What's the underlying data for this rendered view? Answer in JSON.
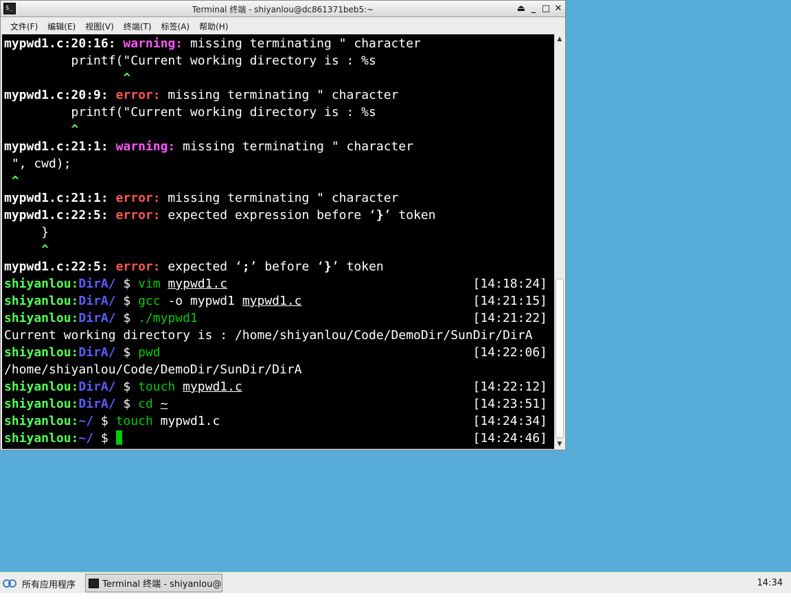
{
  "window": {
    "title": "Terminal 终端 - shiyanlou@dc861371beb5:~",
    "icon": "terminal-icon",
    "controls": [
      "shade-icon",
      "minimize-icon",
      "maximize-icon",
      "close-icon"
    ]
  },
  "menu": [
    {
      "label": "文件(F)"
    },
    {
      "label": "编辑(E)"
    },
    {
      "label": "视图(V)"
    },
    {
      "label": "终端(T)"
    },
    {
      "label": "标签(A)"
    },
    {
      "label": "帮助(H)"
    }
  ],
  "terminal": {
    "lines": [
      {
        "loc": "mypwd1.c:20:16:",
        "kind": "warning:",
        "msg": " missing terminating \" character"
      },
      {
        "text": "         printf(\"Current working directory is : %s"
      },
      {
        "caret": "                ^"
      },
      {
        "loc": "mypwd1.c:20:9:",
        "kind": "error:",
        "msg": " missing terminating \" character"
      },
      {
        "text": "         printf(\"Current working directory is : %s"
      },
      {
        "caret": "         ^"
      },
      {
        "loc": "mypwd1.c:21:1:",
        "kind": "warning:",
        "msg": " missing terminating \" character"
      },
      {
        "text": " \", cwd);"
      },
      {
        "caret": " ^"
      },
      {
        "loc": "mypwd1.c:21:1:",
        "kind": "error:",
        "msg": " missing terminating \" character"
      },
      {
        "loc": "mypwd1.c:22:5:",
        "kind": "error:",
        "msg": " expected expression before ",
        "q1": "‘",
        "bold_tok": "}",
        "q2": "’",
        "tail": " token"
      },
      {
        "text": "     }"
      },
      {
        "caret": "     ^"
      },
      {
        "loc": "mypwd1.c:22:5:",
        "kind": "error:",
        "msg": " expected ",
        "q1": "‘",
        "bold_tok": ";",
        "q2": "’",
        "mid": " before ",
        "q3": "‘",
        "bold_tok2": "}",
        "q4": "’",
        "tail": " token"
      }
    ],
    "prompts": [
      {
        "user": "shiyanlou",
        "colon": ":",
        "dir": "DirA/",
        "sign": " $ ",
        "cmd": "vim",
        "sp": " ",
        "arg": "mypwd1.c",
        "arg_underline": true,
        "time": "[14:18:24]"
      },
      {
        "user": "shiyanlou",
        "colon": ":",
        "dir": "DirA/",
        "sign": " $ ",
        "cmd": "gcc",
        "mid": " -o mypwd1 ",
        "arg": "mypwd1.c",
        "arg_underline": true,
        "time": "[14:21:15]"
      },
      {
        "user": "shiyanlou",
        "colon": ":",
        "dir": "DirA/",
        "sign": " $ ",
        "cmd": "./mypwd1",
        "time": "[14:21:22]"
      },
      {
        "output": "Current working directory is : /home/shiyanlou/Code/DemoDir/SunDir/DirA"
      },
      {
        "user": "shiyanlou",
        "colon": ":",
        "dir": "DirA/",
        "sign": " $ ",
        "cmd": "pwd",
        "time": "[14:22:06]"
      },
      {
        "output": "/home/shiyanlou/Code/DemoDir/SunDir/DirA"
      },
      {
        "user": "shiyanlou",
        "colon": ":",
        "dir": "DirA/",
        "sign": " $ ",
        "cmd": "touch",
        "sp": " ",
        "arg": "mypwd1.c",
        "arg_underline": true,
        "time": "[14:22:12]"
      },
      {
        "user": "shiyanlou",
        "colon": ":",
        "dir": "DirA/",
        "sign": " $ ",
        "cmd": "cd",
        "sp": " ",
        "arg": "~",
        "arg_underline": true,
        "time": "[14:23:51]"
      },
      {
        "user": "shiyanlou",
        "colon": ":",
        "dir": "~/",
        "sign": " $ ",
        "cmd": "touch",
        "plain": " mypwd1.c",
        "time": "[14:24:34]"
      },
      {
        "user": "shiyanlou",
        "colon": ":",
        "dir": "~/",
        "sign": " $ ",
        "cursor": true,
        "time": "[14:24:46]"
      }
    ]
  },
  "taskbar": {
    "start_label": "所有应用程序",
    "task_label": "Terminal 终端 - shiyanlou@···",
    "clock": "14:34"
  }
}
